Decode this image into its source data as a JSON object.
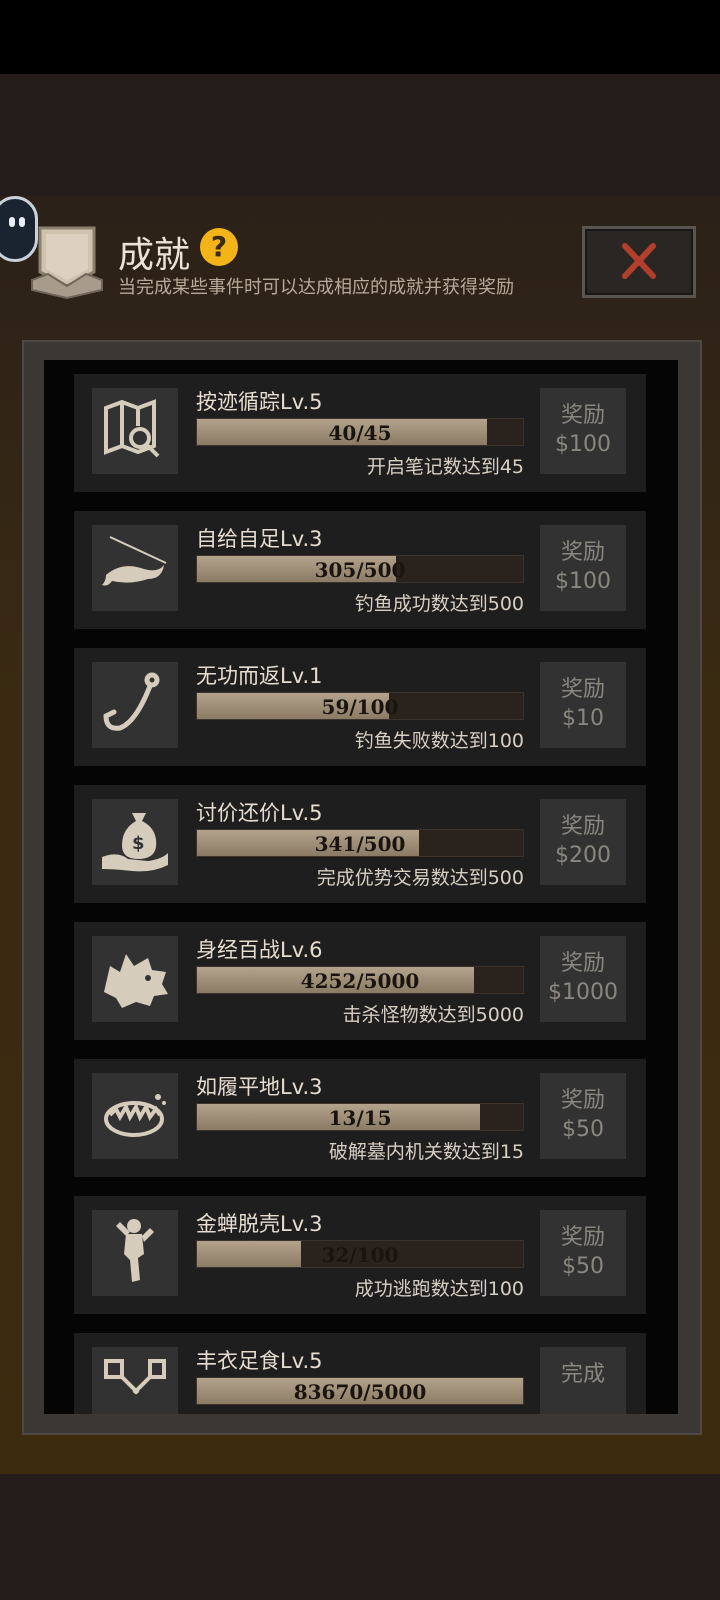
{
  "header": {
    "title": "成就",
    "help_label": "?",
    "subtitle": "当完成某些事件时可以达成相应的成就并获得奖励"
  },
  "colors": {
    "accent": "#f2b418",
    "close_x": "#b13f2c",
    "progress_fill": "#a8977f"
  },
  "achievements": [
    {
      "name": "按迹循踪Lv.5",
      "progress": "40/45",
      "fill": 0.889,
      "desc": "开启笔记数达到45",
      "reward_label": "奖励",
      "reward_amount": "$100",
      "icon": "map-search-icon"
    },
    {
      "name": "自给自足Lv.3",
      "progress": "305/500",
      "fill": 0.61,
      "desc": "钓鱼成功数达到500",
      "reward_label": "奖励",
      "reward_amount": "$100",
      "icon": "fish-icon"
    },
    {
      "name": "无功而返Lv.1",
      "progress": "59/100",
      "fill": 0.59,
      "desc": "钓鱼失败数达到100",
      "reward_label": "奖励",
      "reward_amount": "$10",
      "icon": "fishhook-icon"
    },
    {
      "name": "讨价还价Lv.5",
      "progress": "341/500",
      "fill": 0.682,
      "desc": "完成优势交易数达到500",
      "reward_label": "奖励",
      "reward_amount": "$200",
      "icon": "money-bag-icon"
    },
    {
      "name": "身经百战Lv.6",
      "progress": "4252/5000",
      "fill": 0.85,
      "desc": "击杀怪物数达到5000",
      "reward_label": "奖励",
      "reward_amount": "$1000",
      "icon": "wolf-head-icon"
    },
    {
      "name": "如履平地Lv.3",
      "progress": "13/15",
      "fill": 0.867,
      "desc": "破解墓内机关数达到15",
      "reward_label": "奖励",
      "reward_amount": "$50",
      "icon": "bear-trap-icon"
    },
    {
      "name": "金蝉脱壳Lv.3",
      "progress": "32/100",
      "fill": 0.32,
      "desc": "成功逃跑数达到100",
      "reward_label": "奖励",
      "reward_amount": "$50",
      "icon": "running-figure-icon"
    },
    {
      "name": "丰衣足食Lv.5",
      "progress": "83670/5000",
      "fill": 1.0,
      "desc": "",
      "reward_label": "完成",
      "reward_amount": "",
      "icon": "spatula-icon"
    }
  ]
}
